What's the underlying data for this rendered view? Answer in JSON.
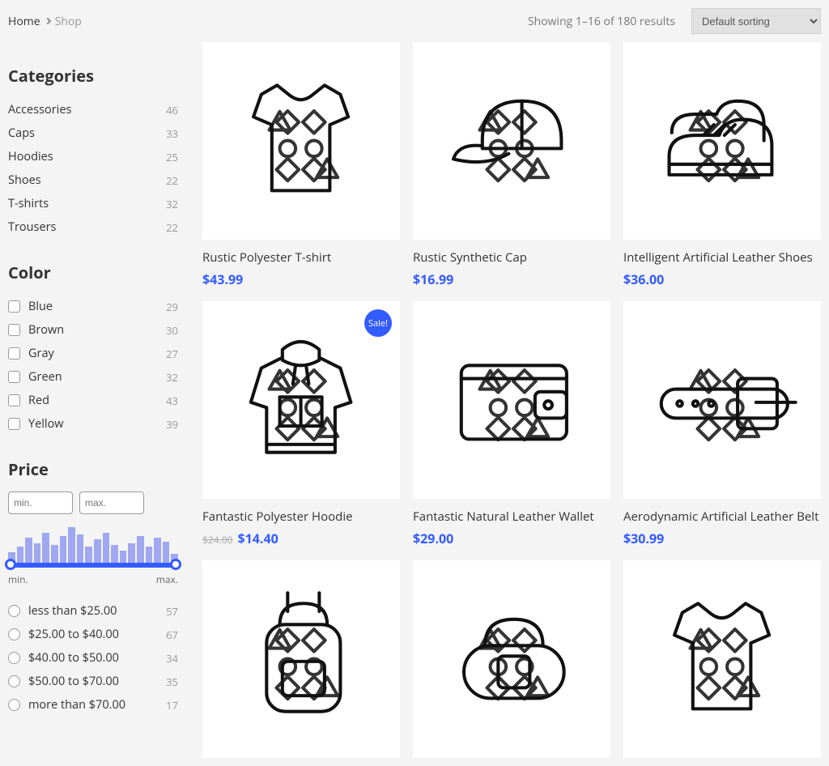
{
  "breadcrumb": {
    "home": "Home",
    "current": "Shop"
  },
  "results_text": "Showing 1–16 of 180 results",
  "sort": {
    "selected": "Default sorting"
  },
  "sidebar": {
    "categories_title": "Categories",
    "categories": [
      {
        "name": "Accessories",
        "count": "46"
      },
      {
        "name": "Caps",
        "count": "33"
      },
      {
        "name": "Hoodies",
        "count": "25"
      },
      {
        "name": "Shoes",
        "count": "22"
      },
      {
        "name": "T-shirts",
        "count": "32"
      },
      {
        "name": "Trousers",
        "count": "22"
      }
    ],
    "color_title": "Color",
    "colors": [
      {
        "name": "Blue",
        "count": "29"
      },
      {
        "name": "Brown",
        "count": "30"
      },
      {
        "name": "Gray",
        "count": "27"
      },
      {
        "name": "Green",
        "count": "32"
      },
      {
        "name": "Red",
        "count": "43"
      },
      {
        "name": "Yellow",
        "count": "39"
      }
    ],
    "price_title": "Price",
    "price_min_placeholder": "min.",
    "price_max_placeholder": "max.",
    "slider_min_label": "min.",
    "slider_max_label": "max.",
    "price_ranges": [
      {
        "label": "less than $25.00",
        "count": "57"
      },
      {
        "label": "$25.00 to $40.00",
        "count": "67"
      },
      {
        "label": "$40.00 to $50.00",
        "count": "34"
      },
      {
        "label": "$50.00 to $70.00",
        "count": "35"
      },
      {
        "label": "more than $70.00",
        "count": "17"
      }
    ],
    "histogram": [
      12,
      18,
      28,
      22,
      34,
      20,
      30,
      40,
      32,
      18,
      26,
      34,
      20,
      14,
      22,
      30,
      18,
      28,
      24,
      10
    ]
  },
  "sale_label": "Sale!",
  "products": [
    {
      "name": "Rustic Polyester T-shirt",
      "price": "$43.99",
      "icon": "tshirt",
      "color": "#2f5fa8",
      "sale": false
    },
    {
      "name": "Rustic Synthetic Cap",
      "price": "$16.99",
      "icon": "cap",
      "color": "#2f5fa8",
      "sale": false
    },
    {
      "name": "Intelligent Artificial Leather Shoes",
      "price": "$36.00",
      "icon": "shoes",
      "color": "#c15a5a",
      "sale": false
    },
    {
      "name": "Fantastic Polyester Hoodie",
      "price": "$14.40",
      "old_price": "$24.00",
      "icon": "hoodie",
      "color": "#7a7a7a",
      "sale": true
    },
    {
      "name": "Fantastic Natural Leather Wallet",
      "price": "$29.00",
      "icon": "wallet",
      "color": "#b0a22f",
      "sale": false
    },
    {
      "name": "Aerodynamic Artificial Leather Belt",
      "price": "$30.99",
      "icon": "belt",
      "color": "#2f8f6f",
      "sale": false
    },
    {
      "name": "",
      "price": "",
      "icon": "backpack",
      "color": "#d4a92f",
      "sale": false
    },
    {
      "name": "",
      "price": "",
      "icon": "bag",
      "color": "#4f8fcf",
      "sale": false
    },
    {
      "name": "",
      "price": "",
      "icon": "tshirt",
      "color": "#d4c84f",
      "sale": false
    }
  ]
}
